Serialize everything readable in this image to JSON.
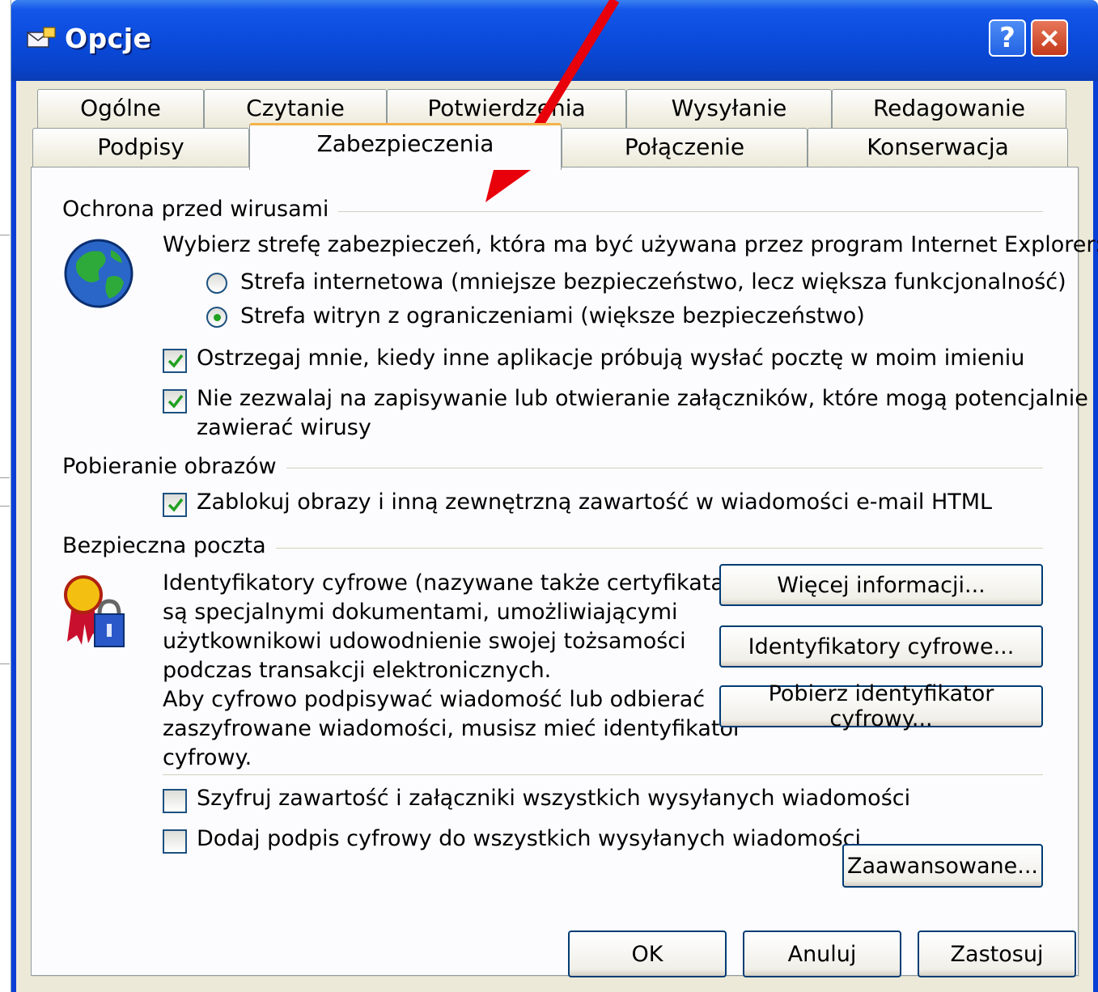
{
  "window": {
    "title": "Opcje",
    "help_label": "?",
    "close_label": "×"
  },
  "tabs_row1": [
    "Ogólne",
    "Czytanie",
    "Potwierdzenia",
    "Wysyłanie",
    "Redagowanie"
  ],
  "tabs_row2": [
    "Podpisy",
    "Zabezpieczenia",
    "Połączenie",
    "Konserwacja"
  ],
  "active_tab": "Zabezpieczenia",
  "virus": {
    "group_label": "Ochrona przed wirusami",
    "zone_prompt": "Wybierz strefę zabezpieczeń, która ma być używana przez program Internet Explorer:",
    "radio_internet": "Strefa internetowa (mniejsze bezpieczeństwo, lecz większa funkcjonalność)",
    "radio_restricted": "Strefa witryn z ograniczeniami (większe bezpieczeństwo)",
    "selected_zone": "restricted",
    "warn_label": "Ostrzegaj mnie, kiedy inne aplikacje próbują wysłać pocztę w moim imieniu",
    "warn_checked": true,
    "attach_label_1": "Nie zezwalaj na zapisywanie lub otwieranie załączników, które mogą potencjalnie",
    "attach_label_2": "zawierać wirusy",
    "attach_checked": true
  },
  "images": {
    "group_label": "Pobieranie obrazów",
    "block_label": "Zablokuj obrazy i inną zewnętrzną zawartość w wiadomości e-mail HTML",
    "block_checked": true
  },
  "secure": {
    "group_label": "Bezpieczna poczta",
    "desc_lines": [
      "Identyfikatory cyfrowe (nazywane także certyfikatami)",
      "są specjalnymi dokumentami, umożliwiającymi",
      "użytkownikowi udowodnienie swojej tożsamości",
      "podczas transakcji elektronicznych.",
      "Aby cyfrowo podpisywać wiadomość lub odbierać",
      "zaszyfrowane wiadomości, musisz mieć identyfikator",
      "cyfrowy."
    ],
    "more_info_button": "Więcej informacji...",
    "digital_ids_button": "Identyfikatory cyfrowe...",
    "get_id_button": "Pobierz identyfikator cyfrowy...",
    "encrypt_label": "Szyfruj zawartość i załączniki wszystkich wysyłanych wiadomości",
    "encrypt_checked": false,
    "sign_label": "Dodaj podpis cyfrowy do wszystkich wysyłanych wiadomości",
    "sign_checked": false,
    "advanced_button": "Zaawansowane..."
  },
  "footer": {
    "ok": "OK",
    "cancel": "Anuluj",
    "apply": "Zastosuj"
  },
  "colors": {
    "titlebar": "#0a4bdc",
    "dialog_bg": "#ece9d8",
    "panel_bg": "#fcfcfe",
    "annotation_arrow": "#e8000b"
  }
}
